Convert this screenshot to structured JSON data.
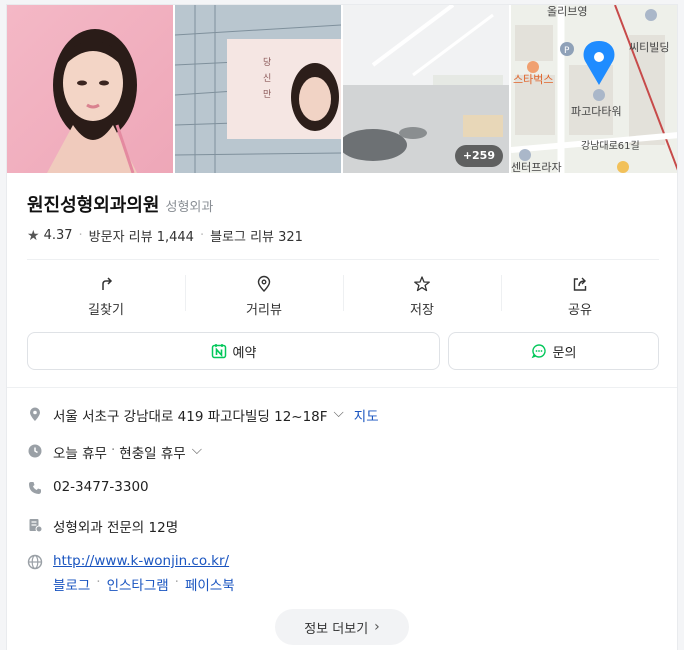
{
  "photos": {
    "more_count": "+259",
    "building_sign": "당신만 빛나도록",
    "map_labels": {
      "oliveyoung": "올리브영",
      "citybuilding": "씨티빌딩",
      "starbucks": "스타벅스",
      "pagoda": "파고다타워",
      "road": "강남대로61길",
      "center": "센터프라자"
    }
  },
  "place": {
    "name": "원진성형외과의원",
    "category": "성형외과",
    "rating": "4.37",
    "visitor_reviews": "방문자 리뷰 1,444",
    "blog_reviews": "블로그 리뷰 321"
  },
  "actions": [
    {
      "label": "길찾기",
      "icon": "directions-icon"
    },
    {
      "label": "거리뷰",
      "icon": "streetview-icon"
    },
    {
      "label": "저장",
      "icon": "star-icon"
    },
    {
      "label": "공유",
      "icon": "share-icon"
    }
  ],
  "buttons": {
    "reserve": "예약",
    "inquiry": "문의"
  },
  "info": {
    "address": "서울 서초구 강남대로 419 파고다빌딩 12~18F",
    "map_link": "지도",
    "hours_status": "오늘 휴무",
    "hours_note": "현충일 휴무",
    "phone": "02-3477-3300",
    "specialists": "성형외과 전문의 12명",
    "homepage": "http://www.k-wonjin.co.kr/",
    "social": [
      "블로그",
      "인스타그램",
      "페이스북"
    ]
  },
  "more_info": "정보 더보기",
  "colors": {
    "accent_blue": "#1a55c0",
    "naver_green": "#03c75a",
    "map_pin": "#1f8cff"
  }
}
